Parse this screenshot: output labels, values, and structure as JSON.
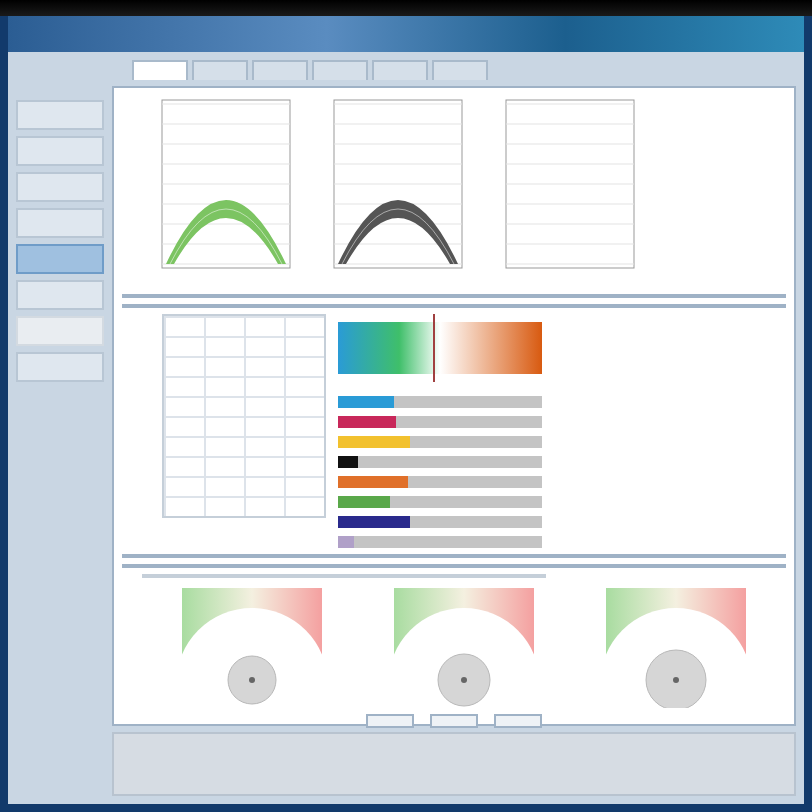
{
  "sidebar": {
    "items": [
      {
        "selected": false,
        "disabled": false
      },
      {
        "selected": false,
        "disabled": false
      },
      {
        "selected": false,
        "disabled": false
      },
      {
        "selected": false,
        "disabled": false
      },
      {
        "selected": true,
        "disabled": false
      },
      {
        "selected": false,
        "disabled": false
      },
      {
        "selected": false,
        "disabled": true
      },
      {
        "selected": false,
        "disabled": false
      }
    ]
  },
  "tabs": [
    {
      "selected": true
    },
    {
      "selected": false
    },
    {
      "selected": false
    },
    {
      "selected": false
    },
    {
      "selected": false
    },
    {
      "selected": false
    }
  ],
  "line_plots": [
    {
      "kind": "band",
      "color": "#7cc462"
    },
    {
      "kind": "band",
      "color": "#555555"
    },
    {
      "kind": "empty"
    }
  ],
  "color_bars": [
    {
      "color": "#2a9bd6",
      "level": 0.27
    },
    {
      "color": "#c8285a",
      "level": 0.28
    },
    {
      "color": "#f2c12e",
      "level": 0.35
    },
    {
      "color": "#111111",
      "level": 0.1
    },
    {
      "color": "#e0702a",
      "level": 0.34
    },
    {
      "color": "#5aa84a",
      "level": 0.25
    },
    {
      "color": "#2a2a8c",
      "level": 0.35
    },
    {
      "color": "#b0a0c8",
      "level": 0.08
    }
  ],
  "target_plots": [
    {
      "kind": "target"
    },
    {
      "kind": "target"
    },
    {
      "kind": "target"
    }
  ],
  "buttons": [
    {
      "kind": "button"
    },
    {
      "kind": "button"
    },
    {
      "kind": "button"
    }
  ]
}
